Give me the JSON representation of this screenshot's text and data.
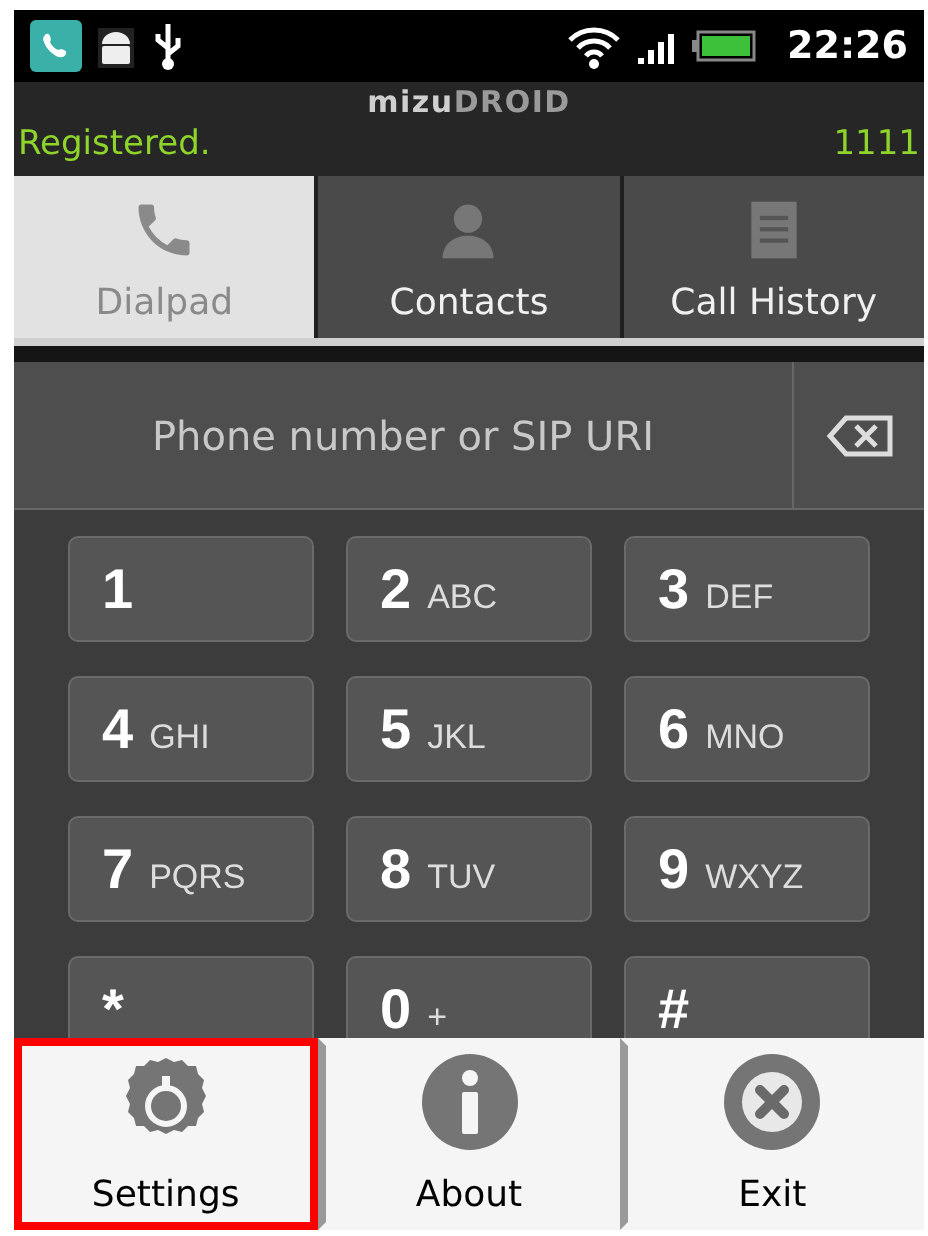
{
  "status_bar": {
    "time": "22:26"
  },
  "header": {
    "logo_left": "mizu",
    "logo_right": "DROID",
    "status": "Registered.",
    "account": "1111"
  },
  "tabs": [
    {
      "label": "Dialpad",
      "kind": "phone",
      "selected": true
    },
    {
      "label": "Contacts",
      "kind": "person",
      "selected": false
    },
    {
      "label": "Call History",
      "kind": "list",
      "selected": false
    }
  ],
  "number_field": {
    "placeholder": "Phone number or SIP URI"
  },
  "keys": [
    {
      "digit": "1"
    },
    {
      "digit": "2",
      "letters": "ABC"
    },
    {
      "digit": "3",
      "letters": "DEF"
    },
    {
      "digit": "4",
      "letters": "GHI"
    },
    {
      "digit": "5",
      "letters": "JKL"
    },
    {
      "digit": "6",
      "letters": "MNO"
    },
    {
      "digit": "7",
      "letters": "PQRS"
    },
    {
      "digit": "8",
      "letters": "TUV"
    },
    {
      "digit": "9",
      "letters": "WXYZ"
    },
    {
      "digit": "*"
    },
    {
      "digit": "0",
      "letters": "+"
    },
    {
      "digit": "#"
    }
  ],
  "menu": [
    {
      "label": "Settings",
      "kind": "gear",
      "selected": true
    },
    {
      "label": "About",
      "kind": "info",
      "selected": false
    },
    {
      "label": "Exit",
      "kind": "close",
      "selected": false
    }
  ]
}
